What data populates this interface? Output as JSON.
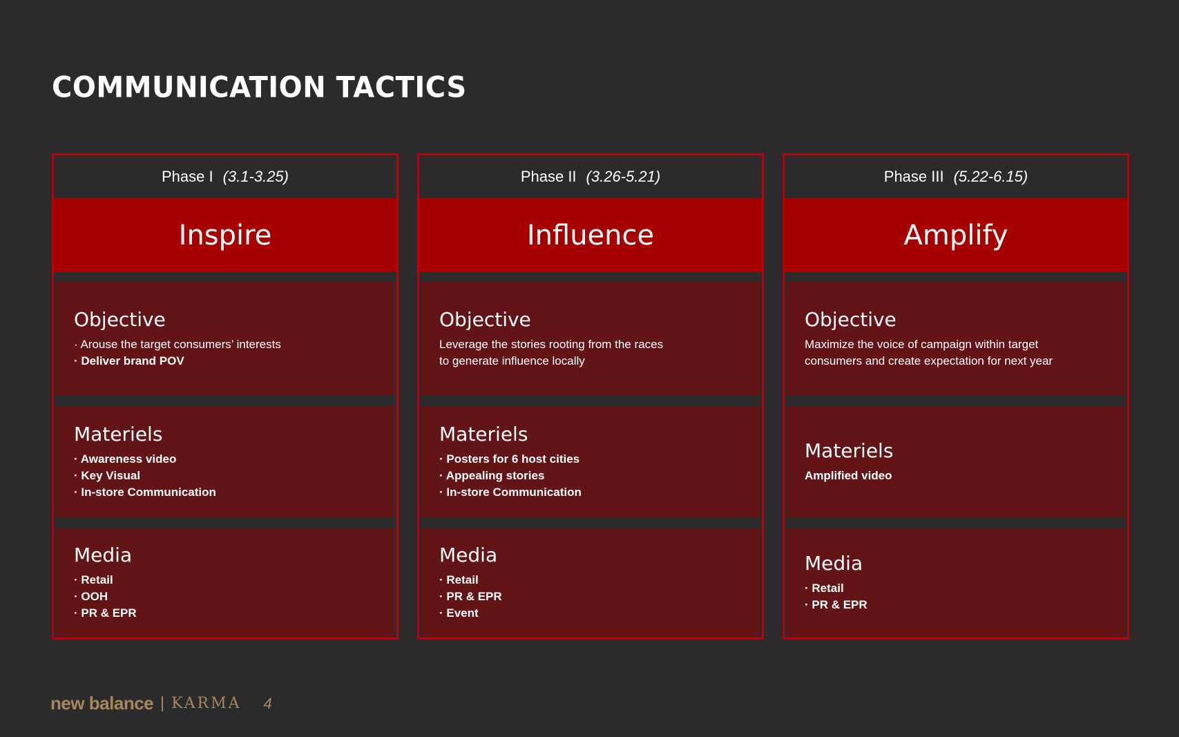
{
  "title": "COMMUNICATION TACTICS",
  "phases": [
    {
      "phase_label": "Phase I",
      "dates": "(3.1-3.25)",
      "name": "Inspire",
      "objective": {
        "title": "Objective",
        "lines": [
          {
            "text": "· Arouse the target consumers’ interests",
            "bold": false
          },
          {
            "text": "· Deliver brand POV",
            "bold": true
          }
        ]
      },
      "materials": {
        "title": "Materiels",
        "lines": [
          "· Awareness video",
          "· Key Visual",
          "· In-store Communication"
        ]
      },
      "media": {
        "title": "Media",
        "lines": [
          "· Retail",
          "· OOH",
          "· PR & EPR"
        ]
      }
    },
    {
      "phase_label": "Phase II",
      "dates": "(3.26-5.21)",
      "name": "Influence",
      "objective": {
        "title": "Objective",
        "lines": [
          {
            "text": "Leverage the stories rooting from the races",
            "bold": false
          },
          {
            "text": "to generate influence locally",
            "bold": false
          }
        ]
      },
      "materials": {
        "title": "Materiels",
        "lines": [
          "· Posters for 6 host cities",
          "· Appealing stories",
          "· In-store Communication"
        ]
      },
      "media": {
        "title": "Media",
        "lines": [
          "· Retail",
          "· PR & EPR",
          "· Event"
        ]
      }
    },
    {
      "phase_label": "Phase III",
      "dates": "(5.22-6.15)",
      "name": "Amplify",
      "objective": {
        "title": "Objective",
        "lines": [
          {
            "text": "Maximize the voice of campaign within target",
            "bold": false
          },
          {
            "text": "consumers and create expectation for next year",
            "bold": false
          }
        ]
      },
      "materials": {
        "title": "Materiels",
        "lines": [
          "Amplified video"
        ]
      },
      "media": {
        "title": "Media",
        "lines": [
          "· Retail",
          "· PR & EPR"
        ]
      }
    }
  ],
  "footer": {
    "brand": "new balance",
    "sub_brand": "KARMA",
    "page_number": "4"
  }
}
